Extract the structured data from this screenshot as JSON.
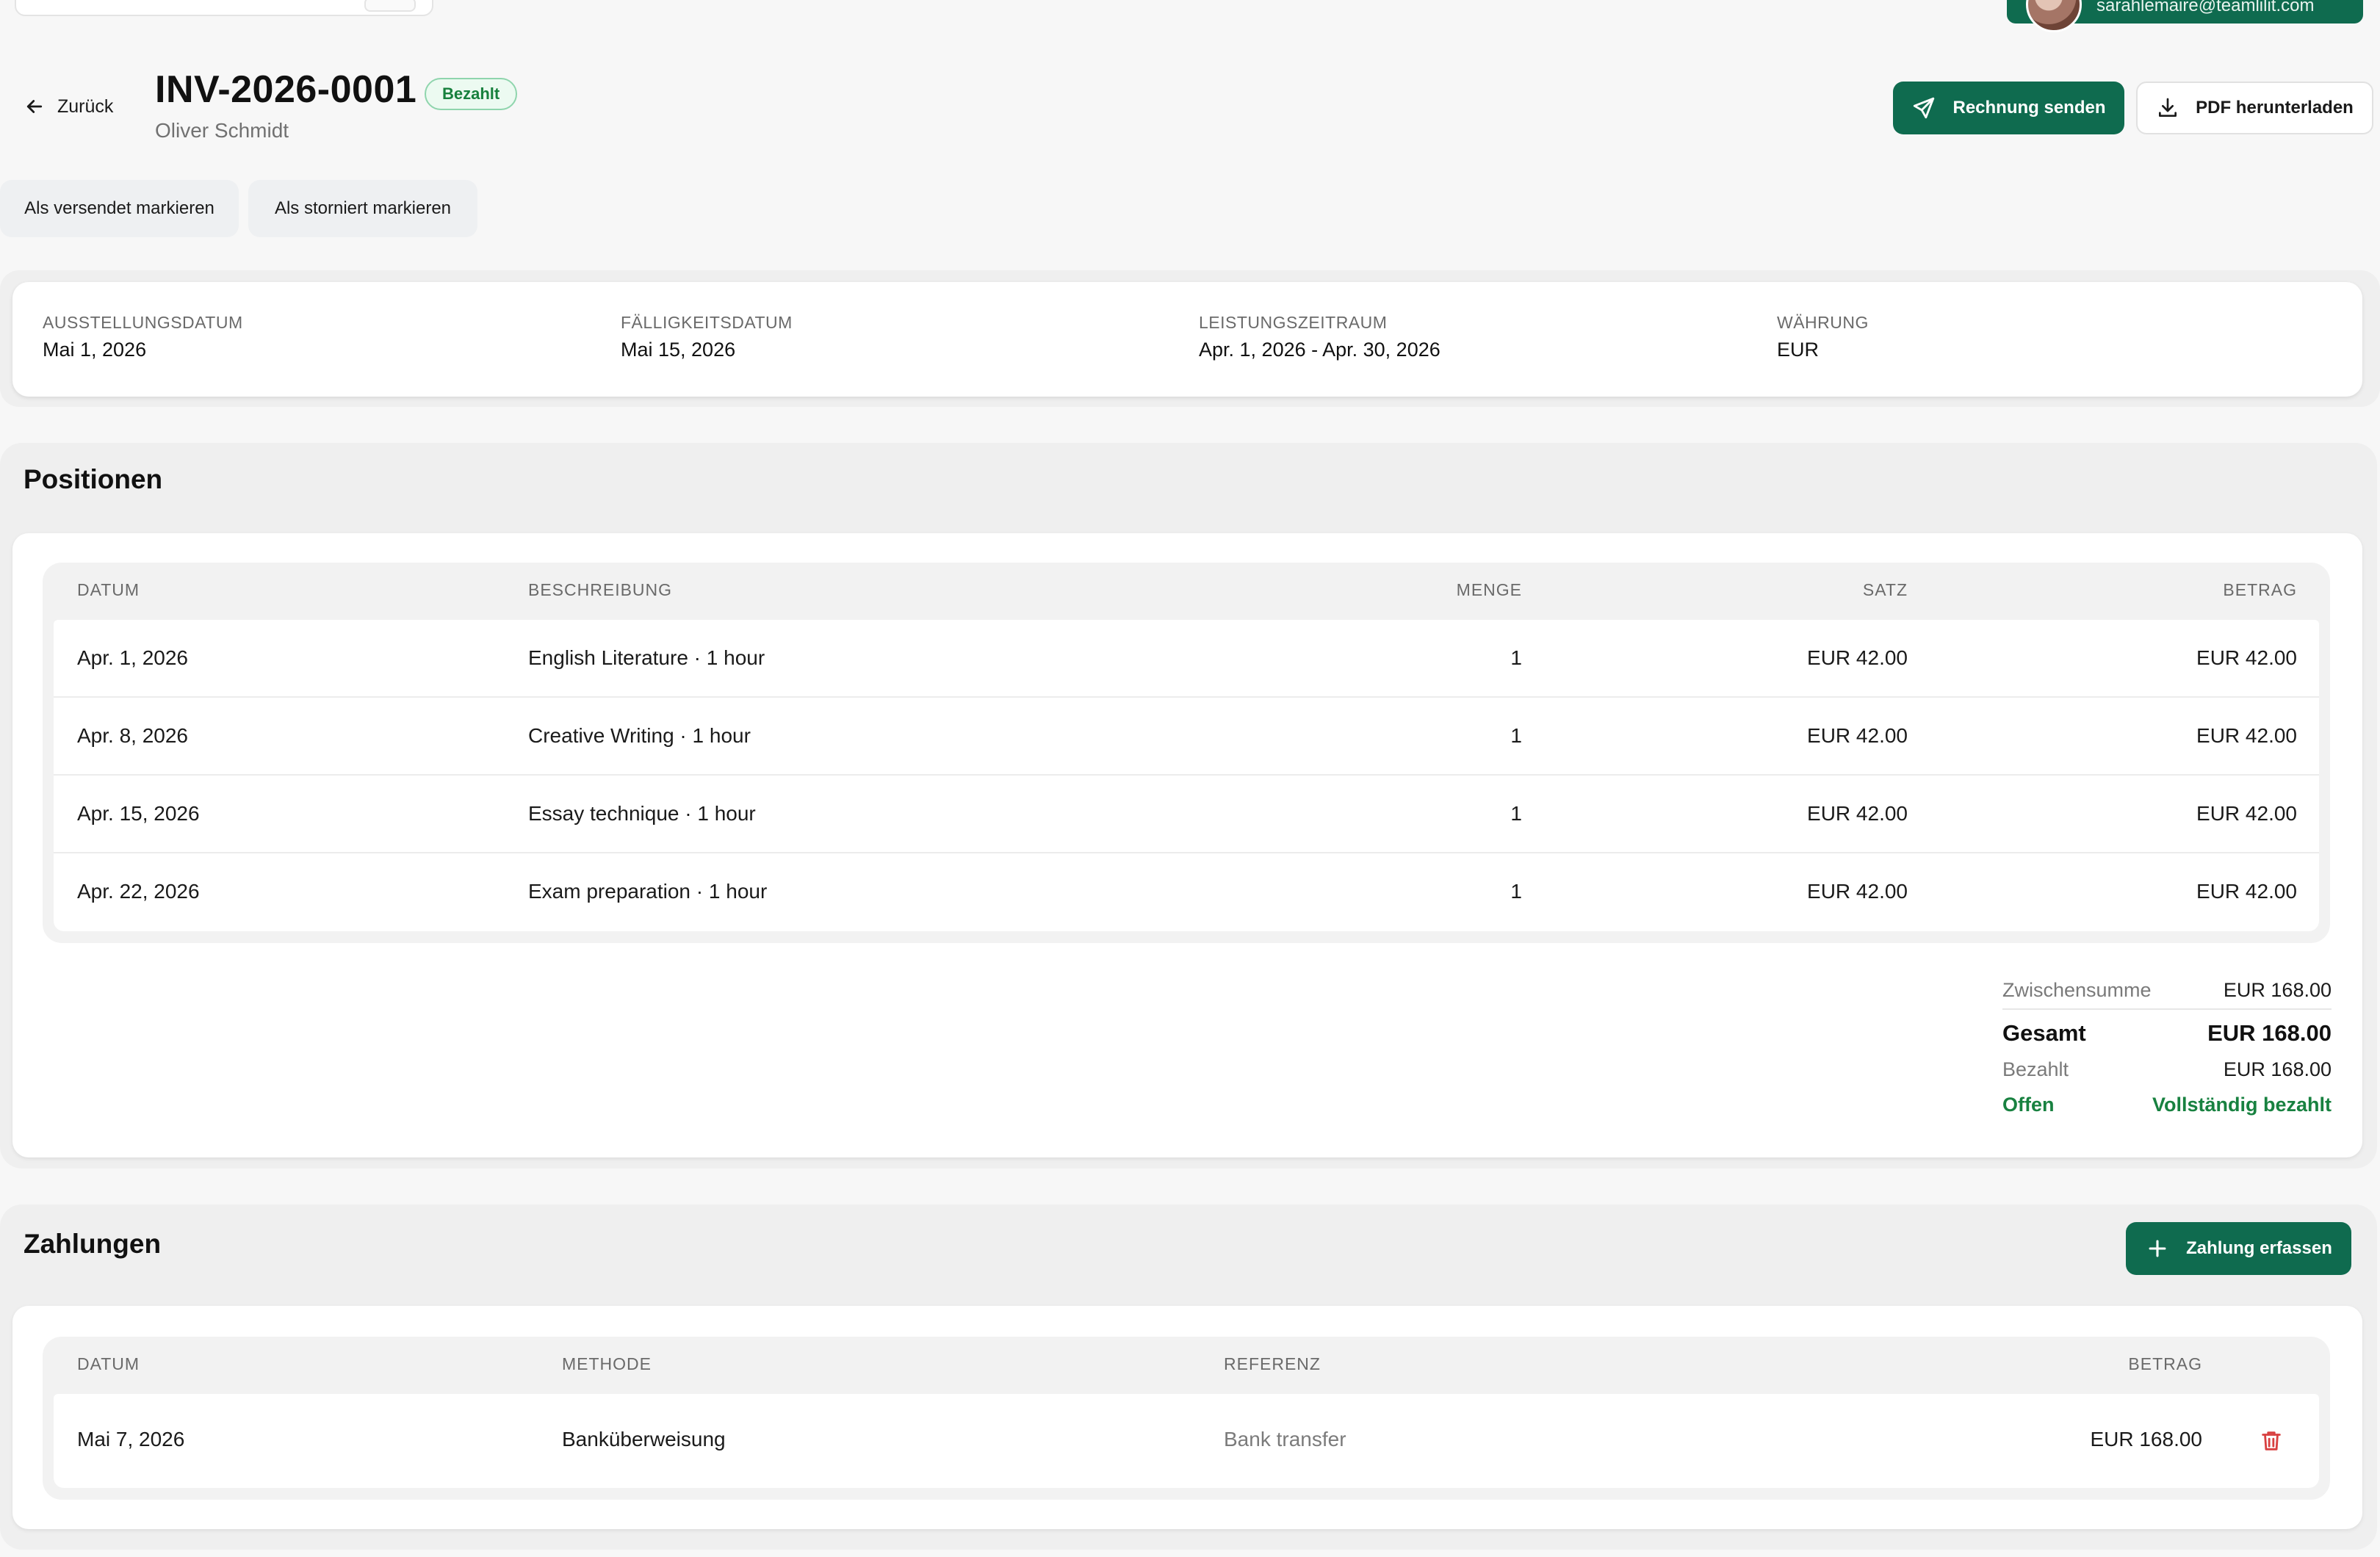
{
  "topbar": {
    "user_email": "sarahlemaire@teamlilit.com"
  },
  "header": {
    "back_label": "Zurück",
    "invoice_number": "INV-2026-0001",
    "status_badge": "Bezahlt",
    "client_name": "Oliver Schmidt",
    "send_label": "Rechnung senden",
    "pdf_label": "PDF herunterladen",
    "mark_sent_label": "Als versendet markieren",
    "mark_cancelled_label": "Als storniert markieren"
  },
  "meta": {
    "issue_date_label": "AUSSTELLUNGSDATUM",
    "issue_date": "Mai 1, 2026",
    "due_date_label": "FÄLLIGKEITSDATUM",
    "due_date": "Mai 15, 2026",
    "period_label": "LEISTUNGSZEITRAUM",
    "period": "Apr. 1, 2026 - Apr. 30, 2026",
    "currency_label": "WÄHRUNG",
    "currency": "EUR"
  },
  "positions": {
    "title": "Positionen",
    "columns": {
      "date": "DATUM",
      "description": "BESCHREIBUNG",
      "quantity": "MENGE",
      "rate": "SATZ",
      "amount": "BETRAG"
    },
    "rows": [
      {
        "date": "Apr. 1, 2026",
        "description": "English Literature · 1 hour",
        "quantity": "1",
        "rate": "EUR 42.00",
        "amount": "EUR 42.00"
      },
      {
        "date": "Apr. 8, 2026",
        "description": "Creative Writing · 1 hour",
        "quantity": "1",
        "rate": "EUR 42.00",
        "amount": "EUR 42.00"
      },
      {
        "date": "Apr. 15, 2026",
        "description": "Essay technique · 1 hour",
        "quantity": "1",
        "rate": "EUR 42.00",
        "amount": "EUR 42.00"
      },
      {
        "date": "Apr. 22, 2026",
        "description": "Exam preparation · 1 hour",
        "quantity": "1",
        "rate": "EUR 42.00",
        "amount": "EUR 42.00"
      }
    ]
  },
  "totals": {
    "subtotal_label": "Zwischensumme",
    "subtotal": "EUR 168.00",
    "total_label": "Gesamt",
    "total": "EUR 168.00",
    "paid_label": "Bezahlt",
    "paid": "EUR 168.00",
    "open_label": "Offen",
    "open": "Vollständig bezahlt"
  },
  "payments": {
    "title": "Zahlungen",
    "add_label": "Zahlung erfassen",
    "columns": {
      "date": "DATUM",
      "method": "METHODE",
      "reference": "REFERENZ",
      "amount": "BETRAG"
    },
    "rows": [
      {
        "date": "Mai 7, 2026",
        "method": "Banküberweisung",
        "reference": "Bank transfer",
        "amount": "EUR 168.00"
      }
    ]
  },
  "colors": {
    "accent": "#0f6b4f",
    "paid_green": "#188140",
    "delete_red": "#d84040"
  },
  "icons": {
    "back": "arrow-left-icon",
    "send": "paper-plane-icon",
    "download": "download-icon",
    "add": "plus-icon",
    "delete": "trash-icon"
  }
}
